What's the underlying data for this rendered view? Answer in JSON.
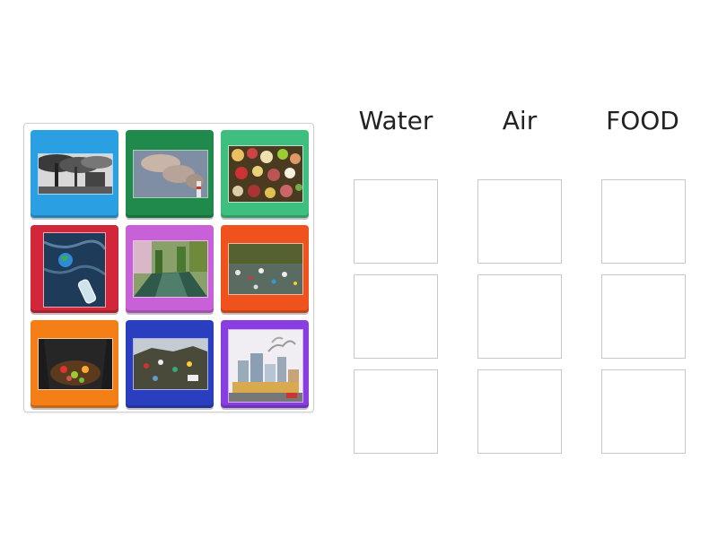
{
  "columns": [
    {
      "title": "Water"
    },
    {
      "title": "Air"
    },
    {
      "title": "FOOD"
    }
  ],
  "tiles": [
    {
      "image": "factory-smokestacks-smoke-image",
      "color": "#2a9fe2"
    },
    {
      "image": "chimney-smoke-plume-image",
      "color": "#1f8a4c"
    },
    {
      "image": "rotting-food-waste-image",
      "color": "#3fbf7f"
    },
    {
      "image": "polluted-water-earth-bottle-image",
      "color": "#d2263a"
    },
    {
      "image": "polluted-canal-image",
      "color": "#c860d8"
    },
    {
      "image": "trash-in-river-image",
      "color": "#f0521e"
    },
    {
      "image": "compost-bin-food-scraps-image",
      "color": "#f57f17"
    },
    {
      "image": "garbage-pile-image",
      "color": "#2a3fc0"
    },
    {
      "image": "city-pollution-illustration-image",
      "color": "#8a3de0"
    }
  ]
}
